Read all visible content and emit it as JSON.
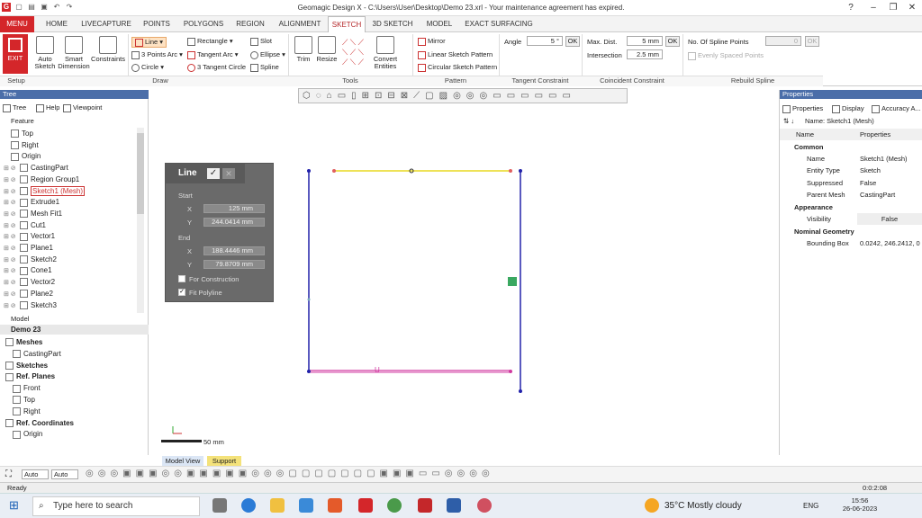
{
  "app": {
    "title": "Geomagic Design X - C:\\Users\\User\\Desktop\\Demo 23.xrl - Your maintenance agreement has expired."
  },
  "tabs": [
    "MENU",
    "HOME",
    "LIVECAPTURE",
    "POINTS",
    "POLYGONS",
    "REGION",
    "ALIGNMENT",
    "SKETCH",
    "3D SKETCH",
    "MODEL",
    "EXACT SURFACING"
  ],
  "ribbon": {
    "exit": "EXIT",
    "auto_sketch": "Auto Sketch",
    "smart_dimension": "Smart Dimension",
    "constraints": "Constraints",
    "line": "Line",
    "three_points_arc": "3 Points Arc",
    "circle": "Circle",
    "rectangle": "Rectangle",
    "tangent_arc": "Tangent Arc",
    "three_tangent_circle": "3 Tangent Circle",
    "slot": "Slot",
    "ellipse": "Ellipse",
    "spline": "Spline",
    "trim": "Trim",
    "resize": "Resize",
    "convert_entities": "Convert Entities",
    "mirror": "Mirror",
    "linear_sketch_pattern": "Linear Sketch Pattern",
    "circular_sketch_pattern": "Circular Sketch Pattern",
    "angle_label": "Angle",
    "angle_value": "5 °",
    "ok": "OK",
    "max_dist_label": "Max. Dist.",
    "max_dist_value": "5 mm",
    "intersection_label": "Intersection",
    "intersection_value": "2.5 mm",
    "spline_points_label": "No. Of Spline Points",
    "spline_points_value": "0",
    "evenly_spaced": "Evenly Spaced Points",
    "groups": [
      "Setup",
      "Draw",
      "Tools",
      "Pattern",
      "Tangent Constraint",
      "Coincident Constraint",
      "Rebuild Spline"
    ]
  },
  "tree": {
    "header": "Tree",
    "tabs": [
      "Tree",
      "Help",
      "Viewpoint"
    ],
    "feature_label": "Feature",
    "items": [
      "Top",
      "Right",
      "Origin",
      "CastingPart",
      "Region Group1",
      "Sketch1 (Mesh)",
      "Extrude1",
      "Mesh Fit1",
      "Cut1",
      "Vector1",
      "Plane1",
      "Sketch2",
      "Cone1",
      "Vector2",
      "Plane2",
      "Sketch3"
    ],
    "model_label": "Model",
    "model_root": "Demo 23",
    "model_items": [
      "Meshes",
      "CastingPart",
      "Sketches",
      "Ref. Planes",
      "Front",
      "Top",
      "Right",
      "Ref. Coordinates",
      "Origin"
    ]
  },
  "dialog": {
    "title": "Line",
    "start": "Start",
    "x_label": "X",
    "y_label": "Y",
    "start_x": "125 mm",
    "start_y": "244.0414 mm",
    "end": "End",
    "end_x": "188.4446 mm",
    "end_y": "79.8709 mm",
    "for_construction": "For Construction",
    "fit_polyline": "Fit Polyline"
  },
  "viewport": {
    "scale_label": "50 mm",
    "tab_model_view": "Model View",
    "tab_support": "Support"
  },
  "properties": {
    "header": "Properties",
    "tabs": [
      "Properties",
      "Display",
      "Accuracy A..."
    ],
    "name_line": "Name: Sketch1 (Mesh)",
    "col_name": "Name",
    "col_props": "Properties",
    "common": "Common",
    "rows": [
      {
        "k": "Name",
        "v": "Sketch1 (Mesh)"
      },
      {
        "k": "Entity Type",
        "v": "Sketch"
      },
      {
        "k": "Suppressed",
        "v": "False"
      },
      {
        "k": "Parent Mesh",
        "v": "CastingPart"
      }
    ],
    "appearance": "Appearance",
    "visibility_k": "Visibility",
    "visibility_v": "False",
    "nominal": "Nominal Geometry",
    "bbox_k": "Bounding Box",
    "bbox_v": "0.0242, 246.2412, 0"
  },
  "bottom": {
    "auto1": "Auto",
    "auto2": "Auto",
    "time": "0:0:2:08"
  },
  "status": {
    "text": "Ready"
  },
  "taskbar": {
    "search": "Type here to search",
    "weather": "35°C Mostly cloudy",
    "lang": "ENG",
    "time": "15:56",
    "date": "26-06-2023"
  },
  "colors": {
    "accent": "#d4262a",
    "panel": "#4b6ea9",
    "sketch_blue": "#2222aa",
    "sketch_magenta": "#d03aa0",
    "sketch_yellow": "#e8d820"
  }
}
